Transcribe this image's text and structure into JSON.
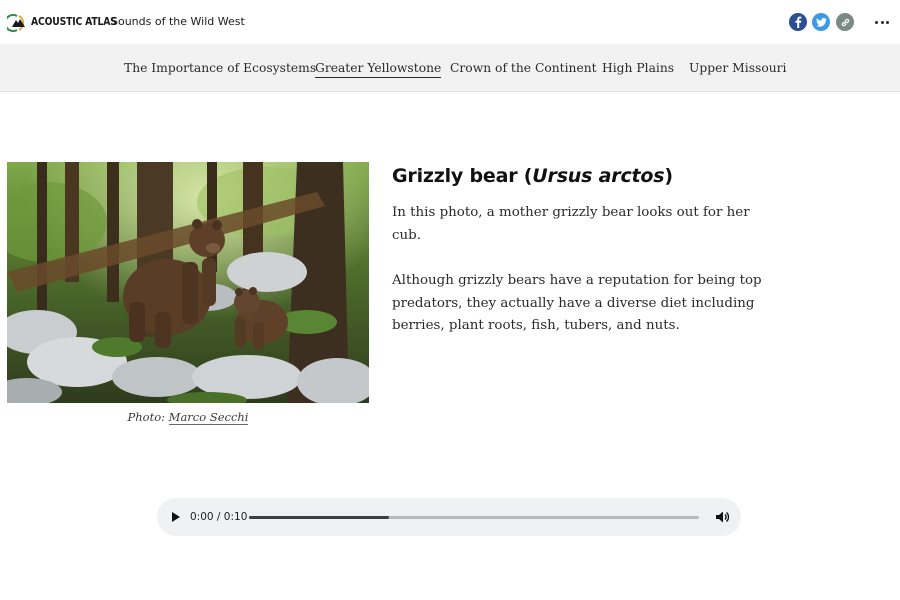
{
  "header": {
    "brand": "ACOUSTIC ATLAS",
    "site_title": "Sounds of the Wild West",
    "share": [
      {
        "icon": "facebook-icon",
        "color": "#2c4f91"
      },
      {
        "icon": "twitter-icon",
        "color": "#3d9ae0"
      },
      {
        "icon": "link-icon",
        "color": "#7a8a85"
      }
    ],
    "more_icon": "more-options-icon"
  },
  "nav": {
    "items": [
      {
        "label": "The Importance of Ecosystems",
        "active": false
      },
      {
        "label": "Greater Yellowstone",
        "active": true
      },
      {
        "label": "Crown of the Continent",
        "active": false
      },
      {
        "label": "High Plains",
        "active": false
      },
      {
        "label": "Upper Missouri",
        "active": false
      }
    ]
  },
  "content": {
    "heading_prefix": "Grizzly bear (",
    "heading_italic": "Ursus arctos",
    "heading_suffix": ")",
    "paragraph_1": "In this photo, a mother grizzly bear looks out for her cub.",
    "paragraph_2": "Although grizzly bears have a reputation for being top predators, they actually have a diverse diet including berries, plant roots, fish, tubers, and nuts.",
    "caption_prefix": "Photo: ",
    "caption_author": "Marco Secchi"
  },
  "audio": {
    "time_display": "0:00 / 0:10",
    "progress_fraction": 0.31
  }
}
